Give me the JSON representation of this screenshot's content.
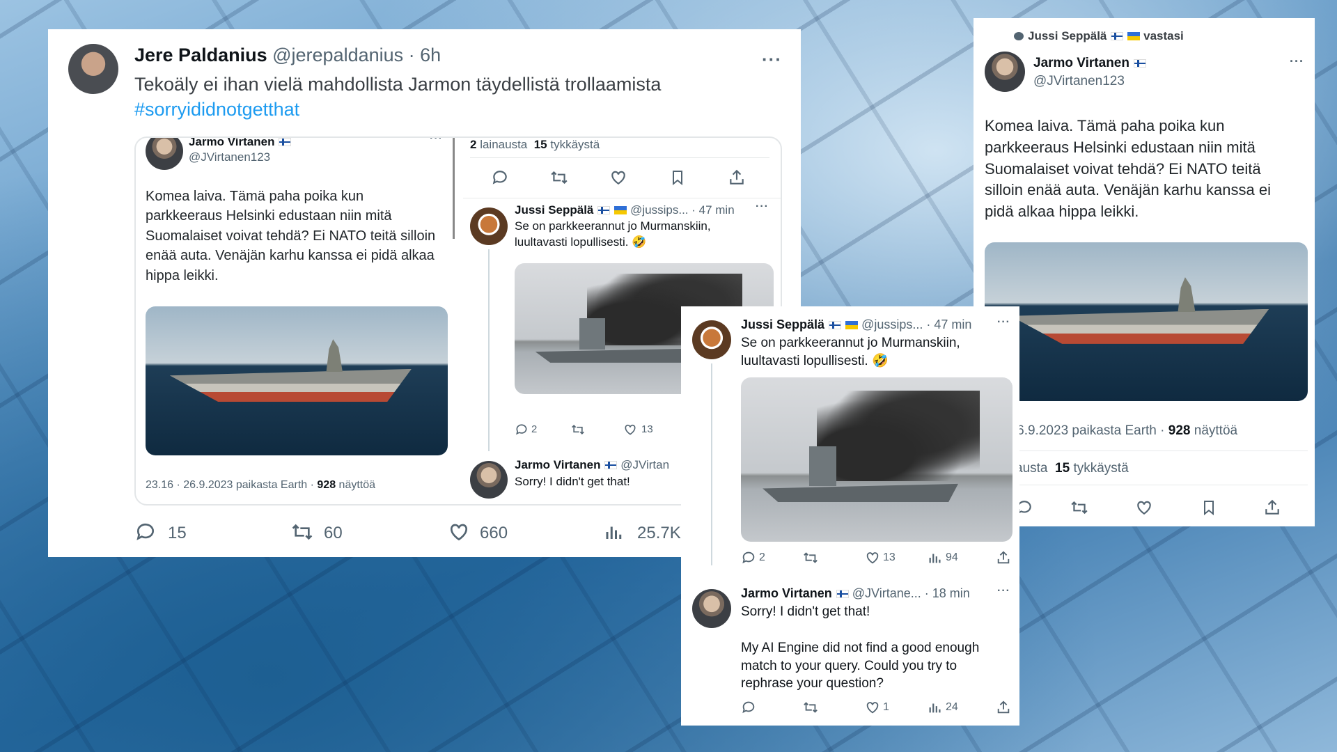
{
  "main_tweet": {
    "author_name": "Jere Paldanius",
    "handle_time": "@jerepaldanius · 6h",
    "text": "Tekoäly ei ihan vielä mahdollista Jarmon täydellistä trollaamista",
    "hashtag": "#sorryididnotgetthat",
    "more": "···",
    "reply_count": "15",
    "retweet_count": "60",
    "like_count": "660",
    "views_count": "25.7K"
  },
  "embed_left": {
    "author_name": "Jarmo Virtanen",
    "handle": "@JVirtanen123",
    "text": "Komea laiva. Tämä paha poika kun parkkeeraus Helsinki edustaan niin mitä Suomalaiset voivat tehdä? Ei NATO teitä silloin enää auta. Venäjän karhu kanssa ei pidä alkaa hippa leikki.",
    "meta_time": "23.16 · 26.9.2023 paikasta Earth · ",
    "views": "928",
    "views_label": " näyttöä"
  },
  "embed_right": {
    "quotes_count": "2",
    "quotes_label": " lainausta",
    "likes_count": "15",
    "likes_label": " tykkäystä",
    "reply1_name": "Jussi Seppälä",
    "reply1_handle_time": "@jussips... · 47 min",
    "reply1_text": "Se on parkkeerannut jo Murmanskiin, luultavasti lopullisesti. 🤣",
    "reply1_replies": "2",
    "reply1_likes": "13",
    "reply2_name": "Jarmo Virtanen",
    "reply2_handle": "@JVirtan",
    "reply2_text": "Sorry! I didn't get that!"
  },
  "right_card": {
    "replied_by": "Jussi Seppälä",
    "replied_label": "vastasi",
    "author_name": "Jarmo Virtanen",
    "handle": "@JVirtanen123",
    "text": "Komea laiva. Tämä paha poika kun parkkeeraus Helsinki edustaan niin mitä Suomalaiset voivat tehdä? Ei NATO teitä silloin enää auta. Venäjän karhu kanssa ei pidä alkaa hippa leikki.",
    "meta_time": "· 26.9.2023 paikasta Earth · ",
    "views": "928",
    "views_label": " näyttöä",
    "quotes_label": "austa",
    "likes_count": "15",
    "likes_label": " tykkäystä"
  },
  "middle_card": {
    "reply1_name": "Jussi Seppälä",
    "reply1_handle_time": "@jussips... · 47 min",
    "reply1_text": "Se on parkkeerannut jo Murmanskiin, luultavasti lopullisesti. 🤣",
    "reply1_replies": "2",
    "reply1_likes": "13",
    "reply1_views": "94",
    "reply2_name": "Jarmo Virtanen",
    "reply2_handle_time": "@JVirtane... · 18 min",
    "reply2_line1": "Sorry! I didn't get that!",
    "reply2_line2": "My AI Engine did not find a good enough match to your query. Could you try to rephrase your question?",
    "reply2_likes": "1",
    "reply2_views": "24"
  }
}
